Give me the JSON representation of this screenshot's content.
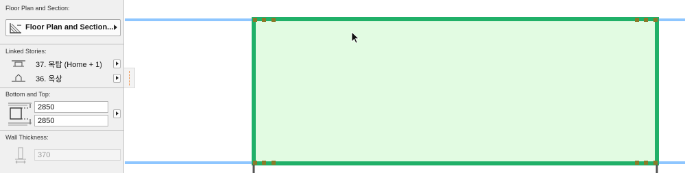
{
  "panel": {
    "floor_plan": {
      "section_label": "Floor Plan and Section:",
      "button_label": "Floor Plan and Section...",
      "icon": "floor-plan-section-icon"
    },
    "linked_stories": {
      "section_label": "Linked Stories:",
      "top_story": {
        "label": "37. 옥탑 (Home + 1)",
        "icon": "top-link-icon"
      },
      "bottom_story": {
        "label": "36. 옥상",
        "icon": "bottom-link-icon"
      }
    },
    "bottom_top": {
      "section_label": "Bottom and Top:",
      "top_offset": "2850",
      "bottom_offset": "2850",
      "icon": "wall-height-icon"
    },
    "wall_thickness": {
      "section_label": "Wall Thickness:",
      "value": "370",
      "icon": "thickness-icon"
    }
  },
  "canvas": {
    "colors": {
      "wall_fill": "#e2fbe2",
      "wall_outline": "#20b068",
      "guide_line": "#8ec6ff",
      "node": "#8a7a2a"
    },
    "cursor_icon": "mouse-pointer-icon"
  }
}
